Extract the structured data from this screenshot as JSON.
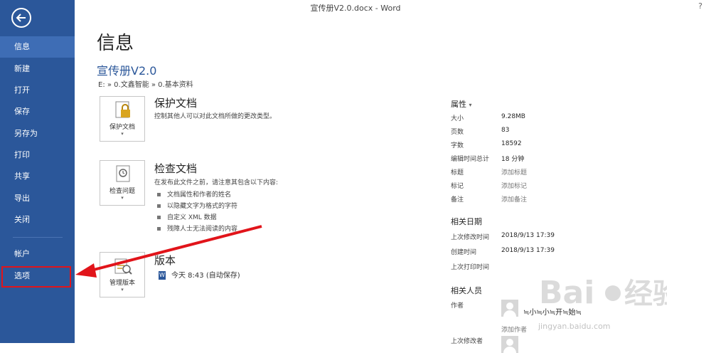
{
  "window": {
    "title": "宣传册V2.0.docx - Word",
    "help": "?"
  },
  "sidebar": {
    "items": [
      {
        "label": "信息"
      },
      {
        "label": "新建"
      },
      {
        "label": "打开"
      },
      {
        "label": "保存"
      },
      {
        "label": "另存为"
      },
      {
        "label": "打印"
      },
      {
        "label": "共享"
      },
      {
        "label": "导出"
      },
      {
        "label": "关闭"
      },
      {
        "label": "帐户"
      },
      {
        "label": "选项"
      }
    ],
    "active": "信息",
    "highlighted": "选项"
  },
  "main": {
    "heading": "信息",
    "doc_title": "宣传册V2.0",
    "path": "E: » 0.文鑫智能 » 0.基本资料",
    "protect": {
      "tile_label": "保护文档",
      "title": "保护文档",
      "desc": "控制其他人可以对此文档所做的更改类型。"
    },
    "inspect": {
      "tile_label": "检查问题",
      "title": "检查文档",
      "desc": "在发布此文件之前，请注意其包含以下内容:",
      "bullets": [
        "文档属性和作者的姓名",
        "以隐藏文字为格式的字符",
        "自定义 XML 数据",
        "残障人士无法阅读的内容"
      ]
    },
    "versions": {
      "tile_label": "管理版本",
      "title": "版本",
      "entry": "今天 8:43 (自动保存)"
    }
  },
  "properties": {
    "heading": "属性",
    "rows": [
      {
        "label": "大小",
        "value": "9.28MB"
      },
      {
        "label": "页数",
        "value": "83"
      },
      {
        "label": "字数",
        "value": "18592"
      },
      {
        "label": "编辑时间总计",
        "value": "18 分钟"
      },
      {
        "label": "标题",
        "value": "添加标题"
      },
      {
        "label": "标记",
        "value": "添加标记"
      },
      {
        "label": "备注",
        "value": "添加备注"
      }
    ],
    "dates_heading": "相关日期",
    "dates": [
      {
        "label": "上次修改时间",
        "value": "2018/9/13 17:39"
      },
      {
        "label": "创建时间",
        "value": "2018/9/13 17:39"
      },
      {
        "label": "上次打印时间",
        "value": ""
      }
    ],
    "people_heading": "相关人员",
    "author_label": "作者",
    "author_name": "≒小≒小≒开≒始≒",
    "add_author": "添加作者",
    "last_modified_by_label": "上次修改者"
  },
  "watermark": {
    "url": "jingyan.baidu.com"
  },
  "colors": {
    "sidebar": "#2b579a",
    "active": "#3e6db5",
    "highlight": "#e1141a",
    "arrow": "#e1141a"
  }
}
